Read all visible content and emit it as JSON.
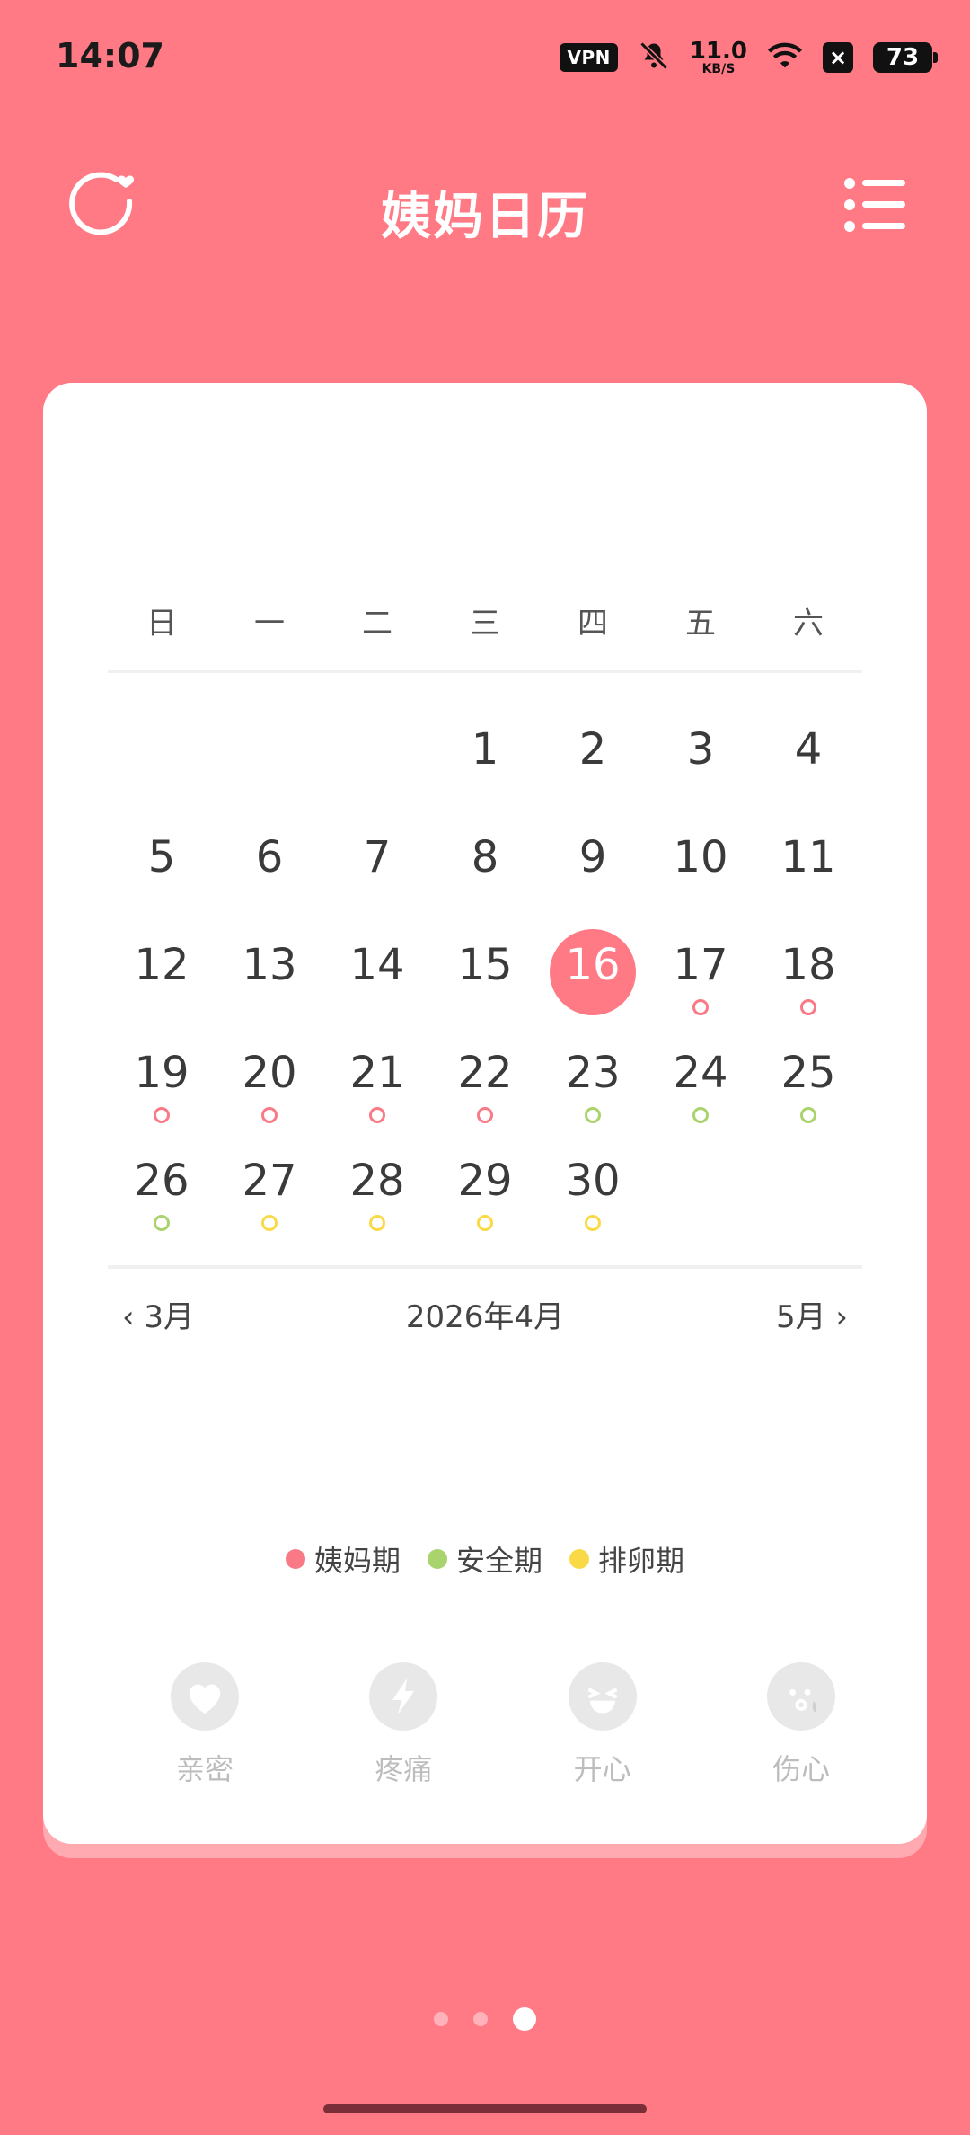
{
  "status": {
    "time": "14:07",
    "vpn": "VPN",
    "speed_value": "11.0",
    "speed_unit": "KB/S",
    "battery": "73"
  },
  "header": {
    "title": "姨妈日历",
    "left_icon": "cycle-heart-icon",
    "right_icon": "list-menu-icon"
  },
  "calendar": {
    "weekdays": [
      "日",
      "一",
      "二",
      "三",
      "四",
      "五",
      "六"
    ],
    "rows": [
      [
        {
          "d": ""
        },
        {
          "d": ""
        },
        {
          "d": ""
        },
        {
          "d": "1"
        },
        {
          "d": "2"
        },
        {
          "d": "3"
        },
        {
          "d": "4"
        }
      ],
      [
        {
          "d": "5"
        },
        {
          "d": "6"
        },
        {
          "d": "7"
        },
        {
          "d": "8"
        },
        {
          "d": "9"
        },
        {
          "d": "10"
        },
        {
          "d": "11"
        }
      ],
      [
        {
          "d": "12"
        },
        {
          "d": "13"
        },
        {
          "d": "14"
        },
        {
          "d": "15"
        },
        {
          "d": "16",
          "today": true
        },
        {
          "d": "17",
          "m": "red"
        },
        {
          "d": "18",
          "m": "red"
        }
      ],
      [
        {
          "d": "19",
          "m": "red"
        },
        {
          "d": "20",
          "m": "red"
        },
        {
          "d": "21",
          "m": "red"
        },
        {
          "d": "22",
          "m": "red"
        },
        {
          "d": "23",
          "m": "green"
        },
        {
          "d": "24",
          "m": "green"
        },
        {
          "d": "25",
          "m": "green"
        }
      ],
      [
        {
          "d": "26",
          "m": "green"
        },
        {
          "d": "27",
          "m": "yellow"
        },
        {
          "d": "28",
          "m": "yellow"
        },
        {
          "d": "29",
          "m": "yellow"
        },
        {
          "d": "30",
          "m": "yellow"
        },
        {
          "d": ""
        },
        {
          "d": ""
        }
      ]
    ],
    "prev_label": "3月",
    "current_label": "2026年4月",
    "next_label": "5月"
  },
  "legend": [
    {
      "label": "姨妈期",
      "color": "#F97A86"
    },
    {
      "label": "安全期",
      "color": "#A9D36C"
    },
    {
      "label": "排卵期",
      "color": "#F9DA46"
    }
  ],
  "moods": [
    {
      "label": "亲密",
      "icon": "heart-icon"
    },
    {
      "label": "疼痛",
      "icon": "lightning-icon"
    },
    {
      "label": "开心",
      "icon": "laugh-face-icon"
    },
    {
      "label": "伤心",
      "icon": "sad-face-icon"
    }
  ],
  "pager": {
    "count": 3,
    "active": 2
  }
}
